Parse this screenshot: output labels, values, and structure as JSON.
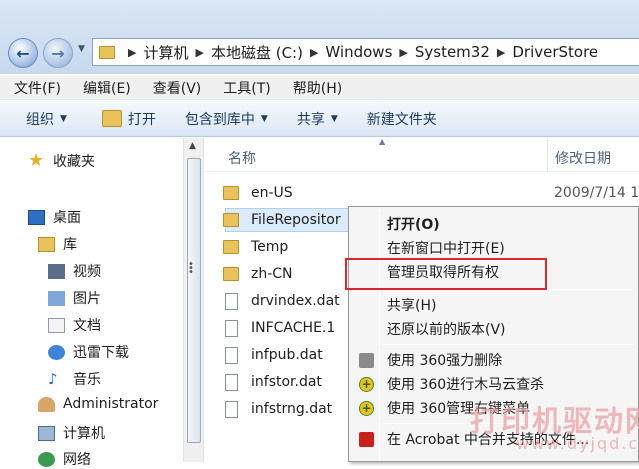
{
  "address": {
    "crumbs": [
      "计算机",
      "本地磁盘 (C:)",
      "Windows",
      "System32",
      "DriverStore"
    ]
  },
  "menubar": [
    "文件(F)",
    "编辑(E)",
    "查看(V)",
    "工具(T)",
    "帮助(H)"
  ],
  "commandbar": {
    "organize": "组织",
    "open": "打开",
    "include_in_library": "包含到库中",
    "share": "共享",
    "new_folder": "新建文件夹"
  },
  "nav": {
    "favorites": "收藏夹",
    "desktop": "桌面",
    "libraries": "库",
    "videos": "视频",
    "pictures": "图片",
    "documents": "文档",
    "thunder_downloads": "迅雷下载",
    "music": "音乐",
    "administrator": "Administrator",
    "computer": "计算机",
    "network": "网络"
  },
  "columns": {
    "name": "名称",
    "date_modified": "修改日期"
  },
  "files": [
    {
      "name": "en-US",
      "type": "folder",
      "date": "2009/7/14 1"
    },
    {
      "name": "FileRepositor",
      "type": "folder",
      "date": ""
    },
    {
      "name": "Temp",
      "type": "folder",
      "date": ""
    },
    {
      "name": "zh-CN",
      "type": "folder",
      "date": ""
    },
    {
      "name": "drvindex.dat",
      "type": "file",
      "date": ""
    },
    {
      "name": "INFCACHE.1",
      "type": "file",
      "date": ""
    },
    {
      "name": "infpub.dat",
      "type": "file",
      "date": ""
    },
    {
      "name": "infstor.dat",
      "type": "file",
      "date": ""
    },
    {
      "name": "infstrng.dat",
      "type": "file",
      "date": ""
    }
  ],
  "context_menu": {
    "open": "打开(O)",
    "open_new_window": "在新窗口中打开(E)",
    "take_ownership": "管理员取得所有权",
    "share": "共享(H)",
    "restore_previous": "还原以前的版本(V)",
    "del_360": "使用 360强力删除",
    "scan_360": "使用 360进行木马云查杀",
    "menu_360": "使用 360管理右键菜单",
    "acrobat": "在 Acrobat 中合并支持的文件..."
  },
  "watermark": {
    "line1": "打印机驱动网",
    "line2": "www.dyjqd.com"
  }
}
